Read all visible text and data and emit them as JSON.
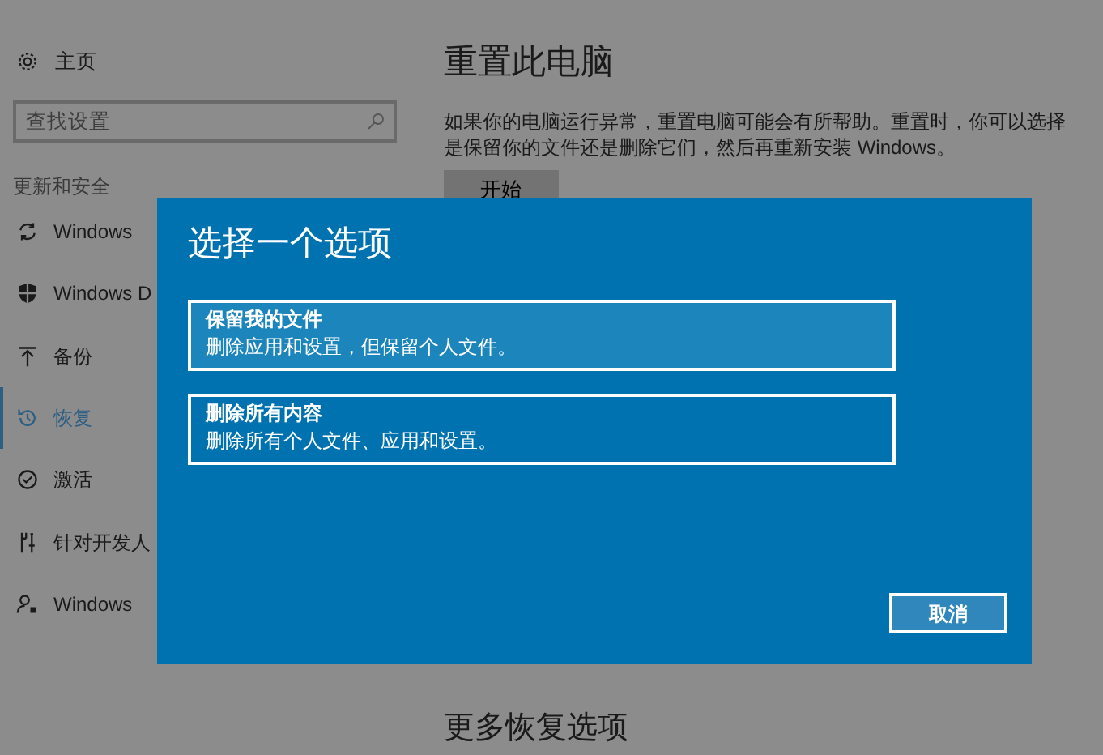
{
  "sidebar": {
    "home": "主页",
    "search": {
      "placeholder": "查找设置"
    },
    "section": "更新和安全",
    "items": [
      {
        "kind": "sync",
        "label": "Windows",
        "selected": false
      },
      {
        "kind": "shield",
        "label": "Windows D",
        "selected": false
      },
      {
        "kind": "backup",
        "label": "备份",
        "selected": false
      },
      {
        "kind": "history",
        "label": "恢复",
        "selected": true
      },
      {
        "kind": "check",
        "label": "激活",
        "selected": false
      },
      {
        "kind": "tools",
        "label": "针对开发人",
        "selected": false
      },
      {
        "kind": "person",
        "label": "Windows",
        "selected": false
      }
    ]
  },
  "content": {
    "title": "重置此电脑",
    "description": "如果你的电脑运行异常，重置电脑可能会有所帮助。重置时，你可以选择是保留你的文件还是删除它们，然后再重新安装 Windows。",
    "start_button": "开始",
    "more_title": "更多恢复选项"
  },
  "dialog": {
    "title": "选择一个选项",
    "options": [
      {
        "title": "保留我的文件",
        "description": "删除应用和设置，但保留个人文件。",
        "selected": true
      },
      {
        "title": "删除所有内容",
        "description": "删除所有个人文件、应用和设置。",
        "selected": false
      }
    ],
    "cancel_button": "取消"
  }
}
